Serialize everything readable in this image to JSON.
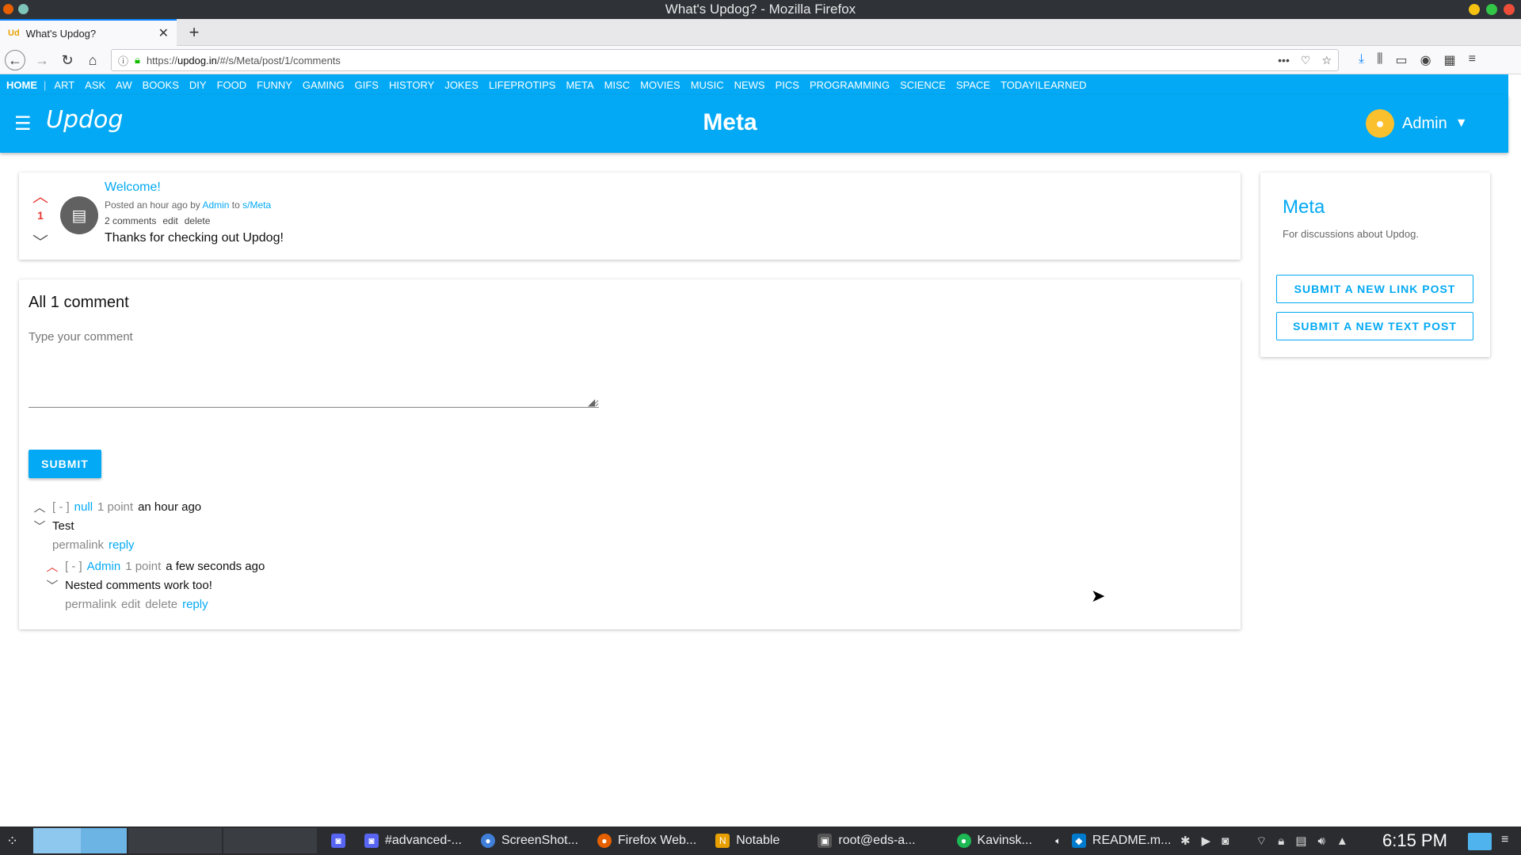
{
  "window": {
    "title": "What's Updog? - Mozilla Firefox"
  },
  "browser": {
    "tab_title": "What's Updog?",
    "tab_favicon": "Ud",
    "url_prefix": "https://",
    "url_domain": "updog.in",
    "url_path": "/#/s/Meta/post/1/comments"
  },
  "subnav": {
    "home": "HOME",
    "separator": "|",
    "items": [
      "ART",
      "ASK",
      "AW",
      "BOOKS",
      "DIY",
      "FOOD",
      "FUNNY",
      "GAMING",
      "GIFS",
      "HISTORY",
      "JOKES",
      "LIFEPROTIPS",
      "META",
      "MISC",
      "MOVIES",
      "MUSIC",
      "NEWS",
      "PICS",
      "PROGRAMMING",
      "SCIENCE",
      "SPACE",
      "TODAYILEARNED"
    ]
  },
  "header": {
    "logo": "Updog",
    "page_title": "Meta",
    "user_name": "Admin"
  },
  "post": {
    "score": "1",
    "title": "Welcome!",
    "meta_prefix": "Posted an hour ago by",
    "author": "Admin",
    "meta_to": "to",
    "sub": "s/Meta",
    "comments_link": "2 comments",
    "edit": "edit",
    "delete": "delete",
    "text": "Thanks for checking out Updog!"
  },
  "comments": {
    "heading": "All 1 comment",
    "placeholder": "Type your comment",
    "submit_label": "SUBMIT",
    "items": [
      {
        "collapse": "[ - ]",
        "author": "null",
        "points": "1 point",
        "time": "an hour ago",
        "text": "Test",
        "permalink": "permalink",
        "reply": "reply"
      },
      {
        "collapse": "[ - ]",
        "author": "Admin",
        "points": "1 point",
        "time": "a few seconds ago",
        "text": "Nested comments work too!",
        "permalink": "permalink",
        "edit": "edit",
        "delete": "delete",
        "reply": "reply"
      }
    ]
  },
  "sidebar": {
    "title": "Meta",
    "description": "For discussions about Updog.",
    "link_post_label": "SUBMIT A NEW LINK POST",
    "text_post_label": "SUBMIT A NEW TEXT POST"
  },
  "taskbar": {
    "tasks": [
      "#advanced-...",
      "ScreenShot...",
      "Firefox Web...",
      "Notable",
      "root@eds-a...",
      "Kavinsk...",
      "README.m..."
    ],
    "clock": "6:15 PM"
  },
  "colors": {
    "accent": "#03a9f4",
    "upvote": "#e53935",
    "avatar": "#fbc02d"
  }
}
